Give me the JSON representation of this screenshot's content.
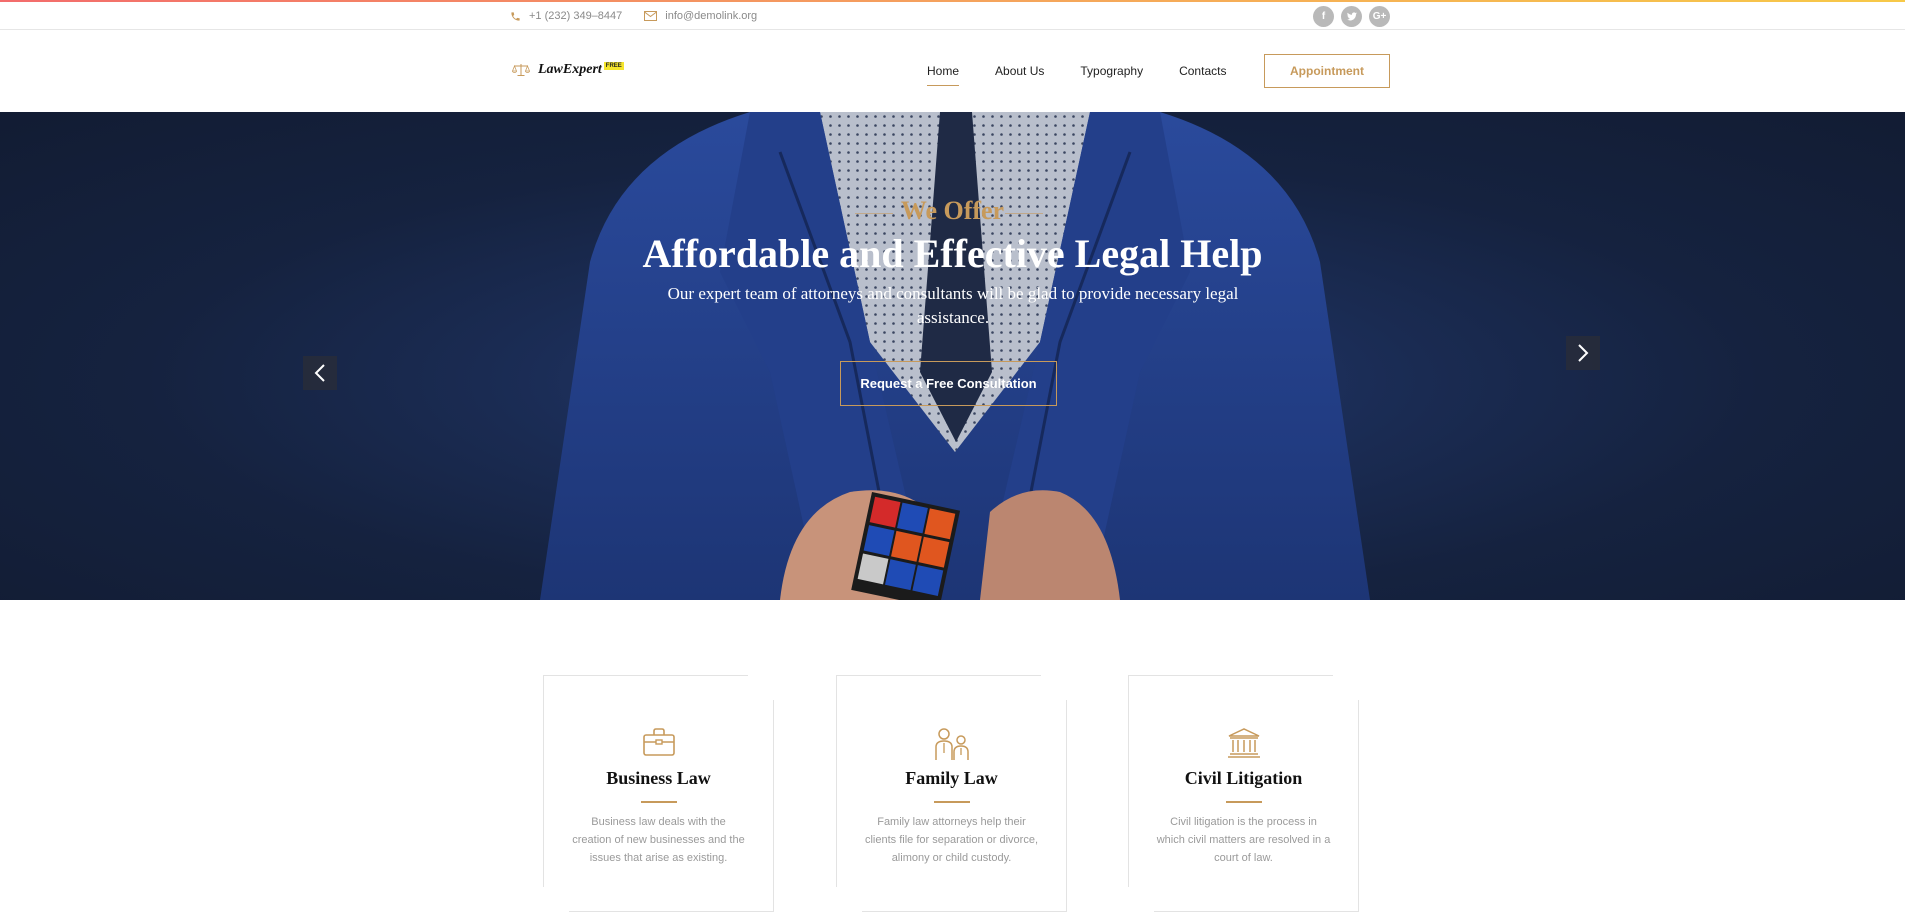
{
  "topbar": {
    "phone": "+1 (232) 349–8447",
    "email": "info@demolink.org",
    "socials": [
      "facebook-icon",
      "twitter-icon",
      "google-plus-icon"
    ]
  },
  "header": {
    "logo_text": "LawExpert",
    "logo_badge": "FREE",
    "nav": [
      {
        "label": "Home",
        "active": true
      },
      {
        "label": "About Us"
      },
      {
        "label": "Typography"
      },
      {
        "label": "Contacts"
      }
    ],
    "cta_label": "Appointment"
  },
  "hero": {
    "eyebrow": "We Offer",
    "title": "Affordable and Effective Legal Help",
    "subtitle": "Our expert team of attorneys and consultants will be glad to provide necessary legal assistance.",
    "button_label": "Request a Free Consultation"
  },
  "services": [
    {
      "icon": "briefcase-icon",
      "title": "Business Law",
      "text": "Business law deals with the creation of new businesses and the issues that arise as existing."
    },
    {
      "icon": "family-icon",
      "title": "Family Law",
      "text": "Family law attorneys help their clients file for separation or divorce, alimony or child custody."
    },
    {
      "icon": "courthouse-icon",
      "title": "Civil Litigation",
      "text": "Civil litigation is the process in which civil matters are resolved in a court of law."
    }
  ],
  "colors": {
    "accent": "#c79a5b",
    "hero_bg": "#1a2b52",
    "suit": "#22408a"
  }
}
